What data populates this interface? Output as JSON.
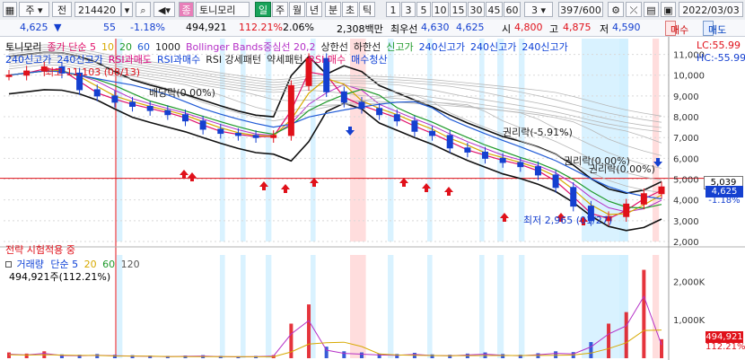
{
  "toolbar": {
    "menu_icon": "menu-icon",
    "type_label": "주",
    "mode_label": "전",
    "code": "214420",
    "name": "토니모리",
    "period_tabs": [
      "일",
      "주",
      "월",
      "년",
      "분",
      "초",
      "틱"
    ],
    "active_period": "일",
    "interval_tabs": [
      "1",
      "3",
      "5",
      "10",
      "15",
      "30",
      "45",
      "60"
    ],
    "interval_value": "3",
    "page_count": "397/600",
    "date": "2022/03/03"
  },
  "infobar": {
    "price": "4,625",
    "change": "55",
    "change_pct": "-1.18%",
    "volume": "494,921",
    "volume_ratio": "112.21%",
    "turnover_pct": "2.06%",
    "amount": "2,308백만",
    "priority_ask_label": "최우선",
    "priority_ask": "4,630",
    "priority_bid": "4,625",
    "open_label": "시",
    "open": "4,800",
    "high_label": "고",
    "high": "4,875",
    "low_label": "저",
    "low": "4,590",
    "buy_label": "매수",
    "sell_label": "매도"
  },
  "legend": {
    "line1": [
      {
        "text": "토니모리",
        "color": "#000000"
      },
      {
        "text": "종가 단순 5",
        "color": "#e0116a"
      },
      {
        "text": "10",
        "color": "#d7a900"
      },
      {
        "text": "20",
        "color": "#1f9a2a"
      },
      {
        "text": "60",
        "color": "#1f5ad6"
      },
      {
        "text": "1000",
        "color": "#222222"
      },
      {
        "text": "Bollinger Bands중심선 20,2",
        "color": "#b530c7"
      },
      {
        "text": "상한선",
        "color": "#222222"
      },
      {
        "text": "하한선",
        "color": "#222222"
      },
      {
        "text": "신고가",
        "color": "#1f9a2a"
      },
      {
        "text": "240신고가",
        "color": "#0b3fd6"
      },
      {
        "text": "240신고가",
        "color": "#0b3fd6"
      },
      {
        "text": "240신고가",
        "color": "#0b3fd6"
      }
    ],
    "line2": [
      {
        "text": "240신고가",
        "color": "#0b3fd6"
      },
      {
        "text": "240신고가",
        "color": "#0b3fd6"
      },
      {
        "text": "RSI과매도",
        "color": "#d8007a"
      },
      {
        "text": "RSI과매수",
        "color": "#0b3fd6"
      },
      {
        "text": "RSI 강세패턴",
        "color": "#222222"
      },
      {
        "text": "약세패턴",
        "color": "#222222"
      },
      {
        "text": "RSI 매수",
        "color": "#e0116a"
      },
      {
        "text": "매수청산",
        "color": "#0b3fd6"
      }
    ],
    "lc_label": "LC:55.99",
    "hc_label": "HC:-55.99"
  },
  "annotations": {
    "high_label": "최고 11,103 (08/13)",
    "dividend_label": "배당락(0.00%)",
    "rights_label": "권리락(-5.91%)",
    "rights2_label": "권리락(0.00%)",
    "rights3_label": "권리락(0.00%)",
    "low_label": "최저 2,965 (01/27)",
    "strategy_label": "전략 시험적용 중"
  },
  "price_axis": {
    "ticks": [
      "11,000",
      "10,000",
      "9,000",
      "8,000",
      "7,000",
      "6,000",
      "5,000",
      "4,000",
      "3,000",
      "2,000"
    ],
    "current_price_box": "5,039",
    "last_price_box": "4,625",
    "change_box": "-1.18%"
  },
  "volume_panel": {
    "legend_title": "거래량",
    "legend_ma": "단순 5",
    "legend_values": [
      "20",
      "60",
      "120"
    ],
    "legend_value_colors": [
      "#d7a900",
      "#1f9a2a",
      "#555555"
    ],
    "volume_text": "494,921주(112.21%)",
    "ticks": [
      "2,000K",
      "1,000K"
    ],
    "volume_box": "494,921",
    "ratio_box": "112.21%"
  },
  "colors": {
    "up": "#e0111a",
    "down": "#1540d0",
    "band": "#111111",
    "highlight_pink": "#ffd4d4",
    "highlight_blue": "#cfefff"
  },
  "chart_data": {
    "type": "line",
    "title": "토니모리",
    "ylabel": "",
    "ylim": [
      2000,
      11500
    ],
    "series": [
      {
        "name": "토니모리",
        "values": [
          10000,
          10200,
          10400,
          10100,
          9300,
          9000,
          8700,
          8500,
          8300,
          8100,
          7800,
          7400,
          7200,
          7100,
          7000,
          7100,
          9500,
          10800,
          9200,
          8700,
          8400,
          8100,
          7800,
          7300,
          7100,
          6500,
          6300,
          6000,
          5800,
          5600,
          5200,
          4600,
          3700,
          3000,
          3200,
          3800,
          4300,
          4625
        ]
      }
    ]
  }
}
